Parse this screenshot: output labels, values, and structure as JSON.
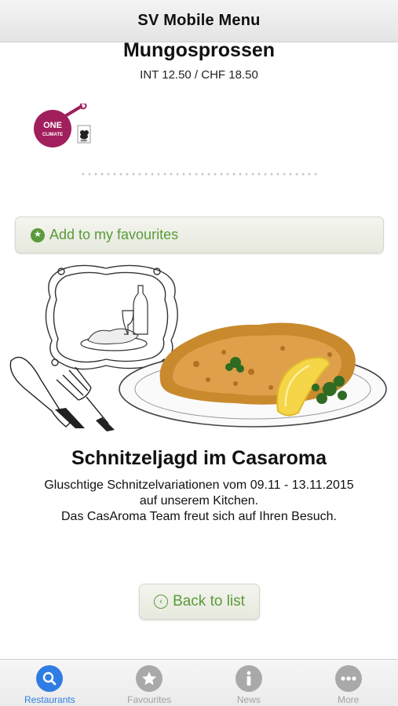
{
  "navbar": {
    "title": "SV Mobile Menu"
  },
  "dish": {
    "name": "Mungosprossen",
    "price": "INT 12.50 / CHF 18.50"
  },
  "badge": {
    "brand": "ONE CLIMATE",
    "partner": "WWF"
  },
  "favourites_button": {
    "label": "Add to my favourites",
    "icon": "star-icon"
  },
  "promo": {
    "title": "Schnitzeljagd im Casaroma",
    "lines": [
      "Gluschtige Schnitzelvariationen vom 09.11 - 13.11.2015",
      "auf unserem Kitchen.",
      "Das CasAroma Team freut sich auf Ihren Besuch."
    ]
  },
  "back_button": {
    "label": "Back to list",
    "icon": "chevron-left-icon"
  },
  "tabbar": {
    "active": "Restaurants",
    "tabs": [
      {
        "label": "Restaurants",
        "icon": "search-icon"
      },
      {
        "label": "Favourites",
        "icon": "star-icon"
      },
      {
        "label": "News",
        "icon": "info-icon"
      },
      {
        "label": "More",
        "icon": "more-icon"
      }
    ]
  },
  "colors": {
    "accent": "#5a9a3c",
    "tab_active": "#2f7de2",
    "tab_inactive": "#a9a9a9",
    "badge": "#a01f5c"
  }
}
